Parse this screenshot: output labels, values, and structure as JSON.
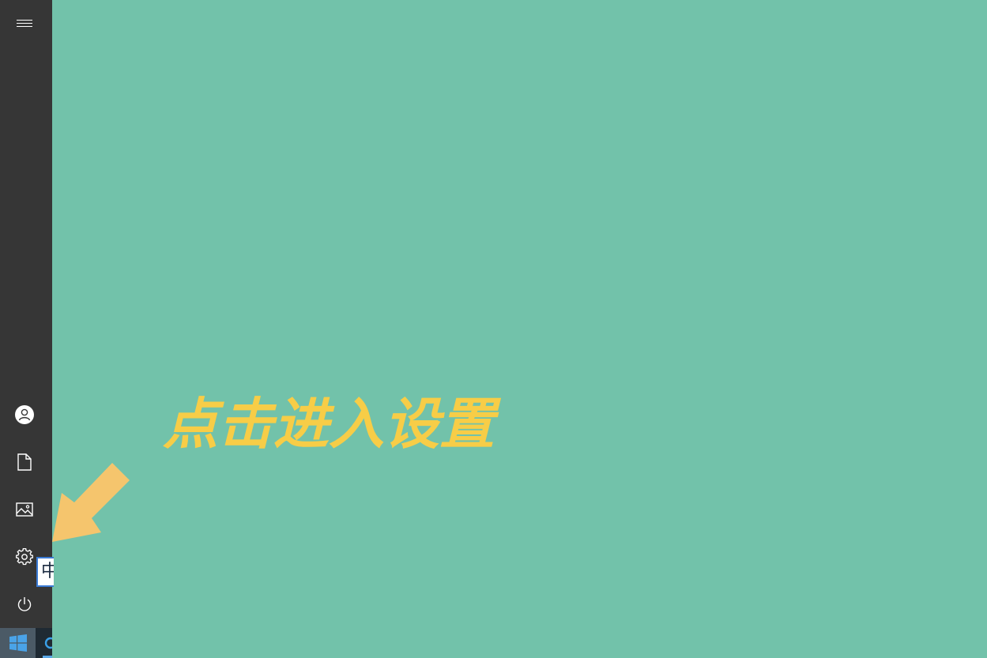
{
  "desktop": {
    "background_color": "#72c2aa"
  },
  "start_menu": {
    "rail_color": "#363636",
    "buttons": [
      {
        "icon": "hamburger-menu-icon"
      },
      {
        "icon": "user-account-icon"
      },
      {
        "icon": "documents-icon"
      },
      {
        "icon": "pictures-icon"
      },
      {
        "icon": "settings-gear-icon"
      },
      {
        "icon": "power-icon"
      }
    ],
    "tooltip": {
      "visible_text": "中"
    }
  },
  "taskbar": {
    "start_icon": "windows-logo-icon",
    "start_color": "#4aa3e8",
    "indicator_color": "#5aa7e6"
  },
  "annotation": {
    "text": "点击进入设置",
    "color": "#f7cd47",
    "arrow_color": "#f5c56d"
  }
}
